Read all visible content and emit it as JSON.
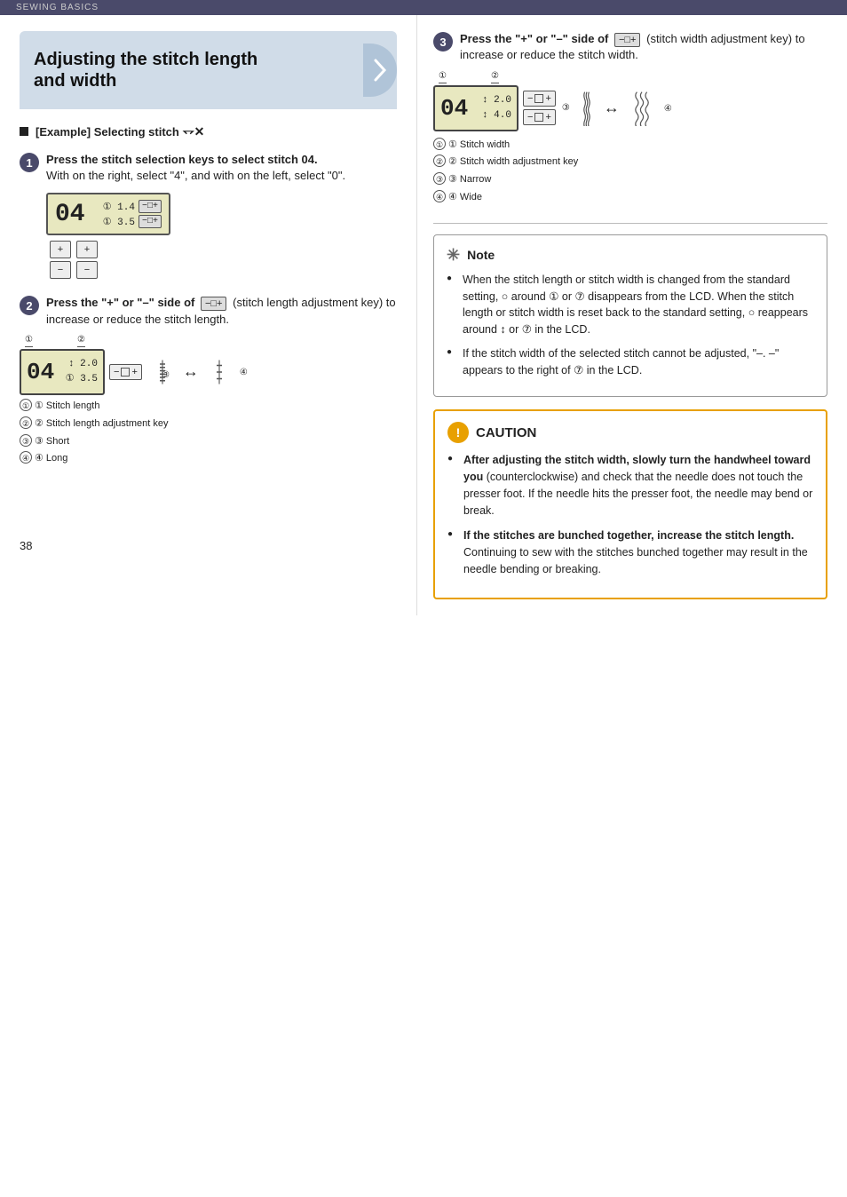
{
  "header": {
    "label": "SEWING BASICS"
  },
  "title": {
    "line1": "Adjusting the stitch length",
    "line2": "and width"
  },
  "example": {
    "label": "[Example] Selecting stitch"
  },
  "step1": {
    "number": "1",
    "instruction": "Press the stitch selection keys to select stitch 04.",
    "detail": "With  on the right, select \"4\", and with  on the left, select \"0\".",
    "lcd_num": "04",
    "lcd_val1": "① 1.4",
    "lcd_val2": "① 3.5",
    "key_label": "−□+"
  },
  "step2": {
    "number": "2",
    "instruction_bold": "Press the \"+\" or \"–\" side of",
    "instruction_key": "−□+",
    "instruction_rest": "(stitch length adjustment key) to increase or reduce the stitch length.",
    "lcd_num": "04",
    "lcd_val1": "↕ 2.0",
    "lcd_val2": "① 3.5",
    "annot1": "① Stitch length",
    "annot2": "② Stitch length adjustment key",
    "annot3": "③ Short",
    "annot4": "④ Long",
    "labels": {
      "circle1": "①",
      "circle2": "②",
      "circle3": "③",
      "circle4": "④"
    }
  },
  "step3": {
    "number": "3",
    "instruction_bold": "Press the \"+\" or \"–\" side of",
    "instruction_key": "−□+",
    "instruction_rest": "(stitch width adjustment key) to increase or reduce the stitch width.",
    "lcd_num": "04",
    "lcd_val1": "↕ 2.0",
    "lcd_val2": "↕ 4.0",
    "annot1": "① Stitch width",
    "annot2": "② Stitch width adjustment key",
    "annot3": "③ Narrow",
    "annot4": "④ Wide"
  },
  "note": {
    "title": "Note",
    "bullets": [
      "When the stitch length or stitch width is changed from the standard setting, ○ around ① or ⑦ disappears from the LCD. When the stitch length or stitch width is reset back to the standard setting, ○ reappears around ↕ or ⑦ in the LCD.",
      "If the stitch width of the selected stitch cannot be adjusted, \"–. –\" appears to the right of ⑦ in the LCD."
    ]
  },
  "caution": {
    "title": "CAUTION",
    "bullets": [
      {
        "bold": "After adjusting the stitch width, slowly turn the handwheel toward you",
        "normal": "(counterclockwise) and check that the needle does not touch the presser foot. If the needle hits the presser foot, the needle may bend or break."
      },
      {
        "bold": "If the stitches are bunched together, increase the stitch length.",
        "normal": "Continuing to sew with the stitches bunched together may result in the needle bending or breaking."
      }
    ]
  },
  "page_number": "38"
}
